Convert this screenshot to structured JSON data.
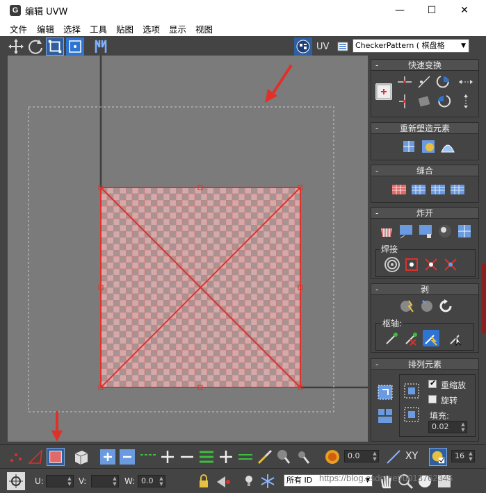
{
  "window": {
    "title": "编辑 UVW",
    "app_icon": "G",
    "minimize": "—",
    "maximize": "☐",
    "close": "✕"
  },
  "menu": [
    "文件",
    "编辑",
    "选择",
    "工具",
    "贴图",
    "选项",
    "显示",
    "视图"
  ],
  "top_toolbar": {
    "uv_label": "UV",
    "texture_select": "CheckerPattern  ( 棋盘格"
  },
  "rollouts": {
    "quick_transform": "快速变换",
    "reshape": "重新塑造元素",
    "stitch": "缝合",
    "explode": "炸开",
    "weld": "焊接",
    "peel": "剥",
    "pivot": "枢轴:",
    "arrange": "排列元素",
    "rescale": "重缩放",
    "rotate": "旋转",
    "padding_label": "填充:",
    "padding_value": "0.02",
    "rescale_checked": true,
    "rotate_checked": false
  },
  "bottom_toolbar": {
    "soft_select_value": "0.0",
    "xy_label": "XY",
    "grid_value": "16"
  },
  "status_bar": {
    "u_label": "U:",
    "v_label": "V:",
    "w_label": "W:",
    "w_value": "0.0",
    "id_filter": "所有 ID"
  },
  "watermark": "https://blog.csdn.net/u013762345",
  "colors": {
    "selection_red": "#e0302a",
    "accent_blue": "#2f74d0",
    "arrow_red": "#e0302a"
  }
}
